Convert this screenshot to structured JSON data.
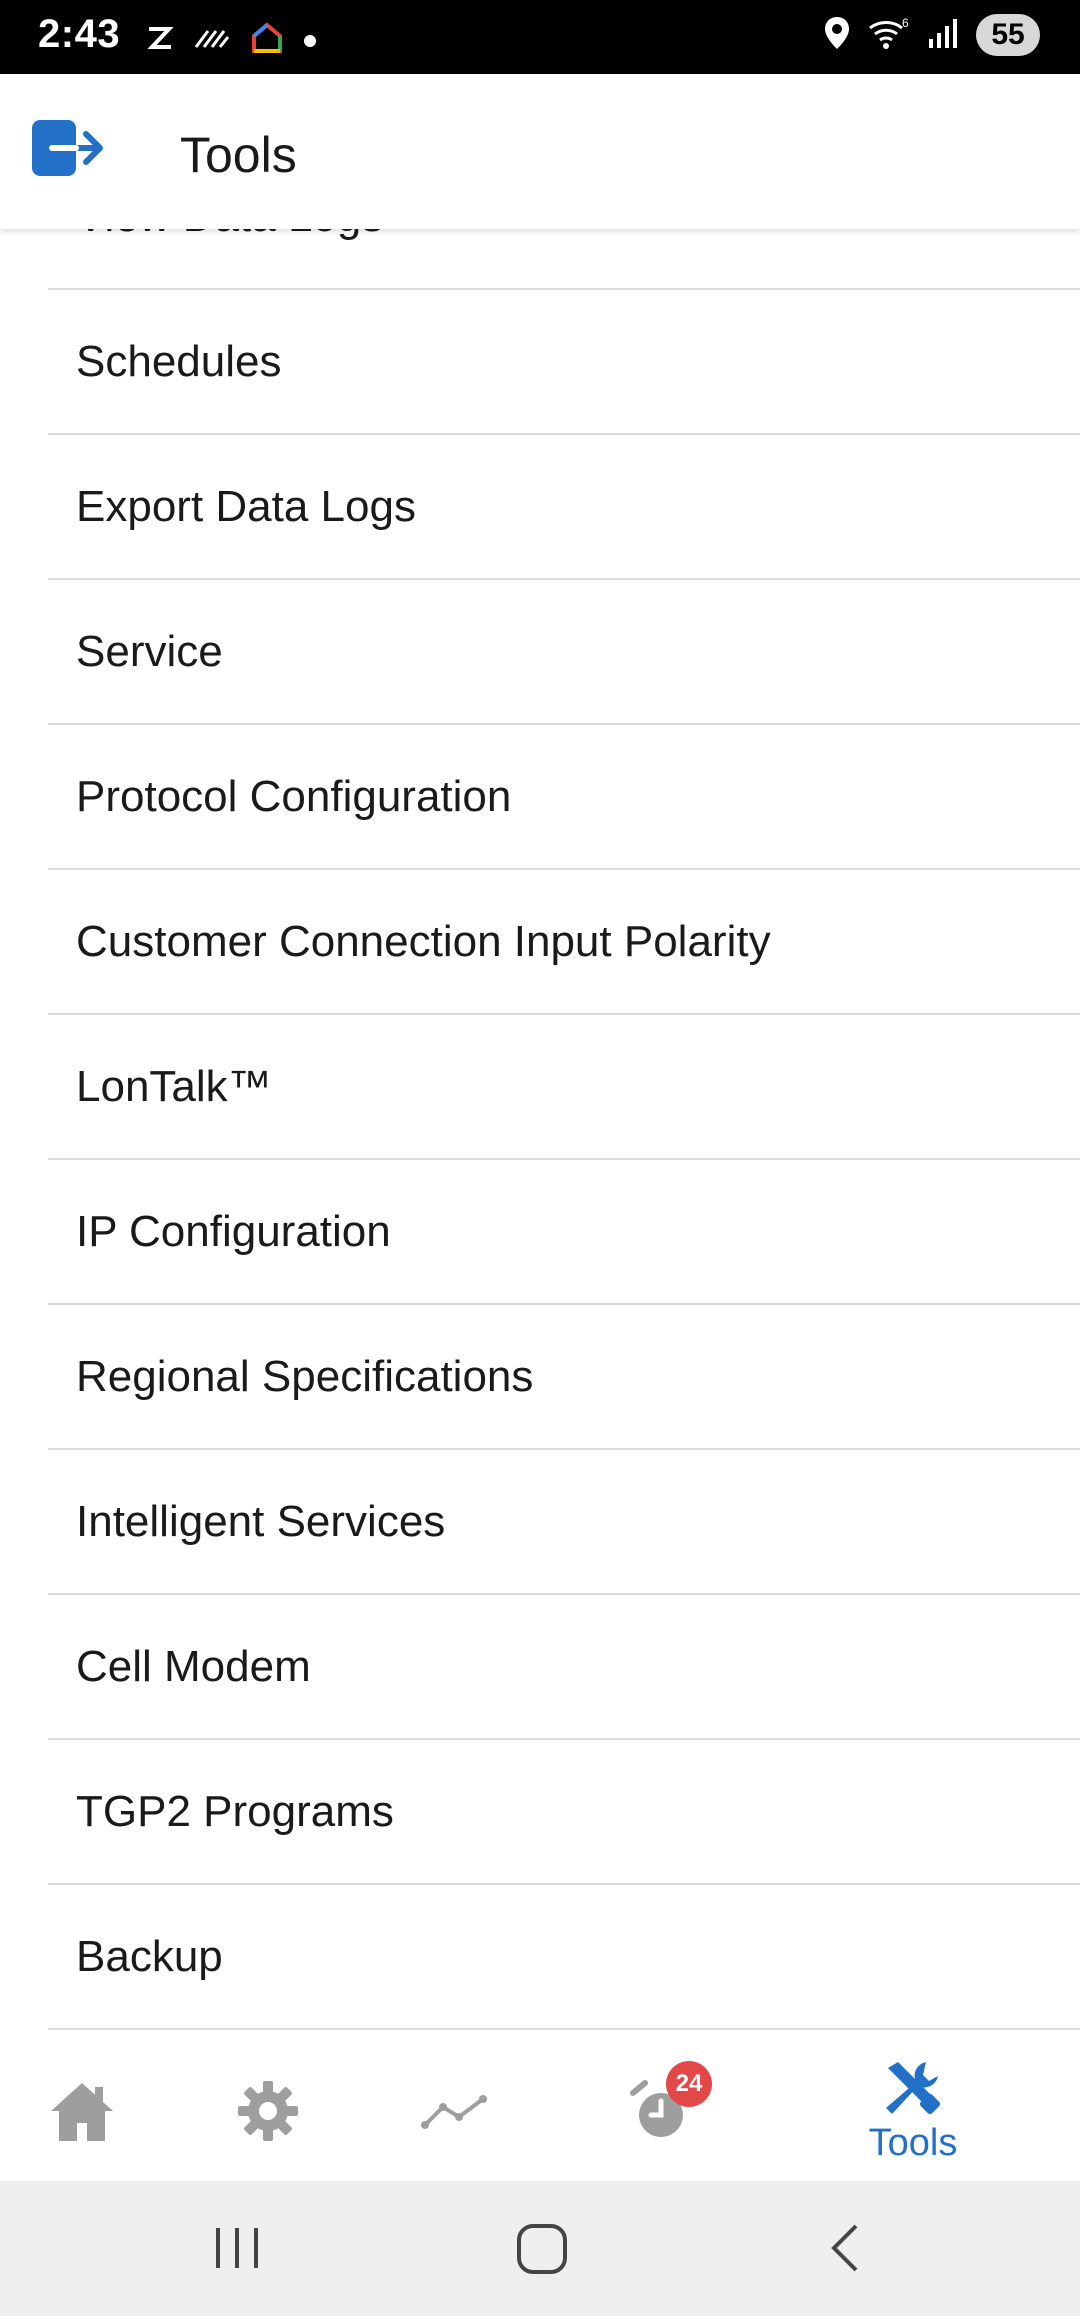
{
  "status_bar": {
    "time": "2:43",
    "battery": "55",
    "icons": [
      "z-notification-icon",
      "striped-notification-icon",
      "home-app-icon",
      "dot-icon",
      "location-icon",
      "wifi-6-icon",
      "signal-icon"
    ]
  },
  "app_bar": {
    "title": "Tools",
    "logout_icon": "logout-icon",
    "accent_color": "#2370c8"
  },
  "menu": {
    "items": [
      {
        "label": "View Data Logs"
      },
      {
        "label": "Schedules"
      },
      {
        "label": "Export Data Logs"
      },
      {
        "label": "Service"
      },
      {
        "label": "Protocol Configuration"
      },
      {
        "label": "Customer Connection Input Polarity"
      },
      {
        "label": "LonTalk™"
      },
      {
        "label": "IP Configuration"
      },
      {
        "label": "Regional Specifications"
      },
      {
        "label": "Intelligent Services"
      },
      {
        "label": "Cell Modem"
      },
      {
        "label": "TGP2 Programs"
      },
      {
        "label": "Backup"
      }
    ]
  },
  "bottom_nav": {
    "items": [
      {
        "icon": "home-icon"
      },
      {
        "icon": "gear-icon"
      },
      {
        "icon": "trend-icon"
      },
      {
        "icon": "alarm-clock-icon",
        "badge": "24"
      },
      {
        "icon": "tools-icon",
        "label": "Tools",
        "active": true
      }
    ]
  },
  "system_nav": {
    "icons": [
      "recent-apps-icon",
      "home-button-icon",
      "back-icon"
    ]
  }
}
